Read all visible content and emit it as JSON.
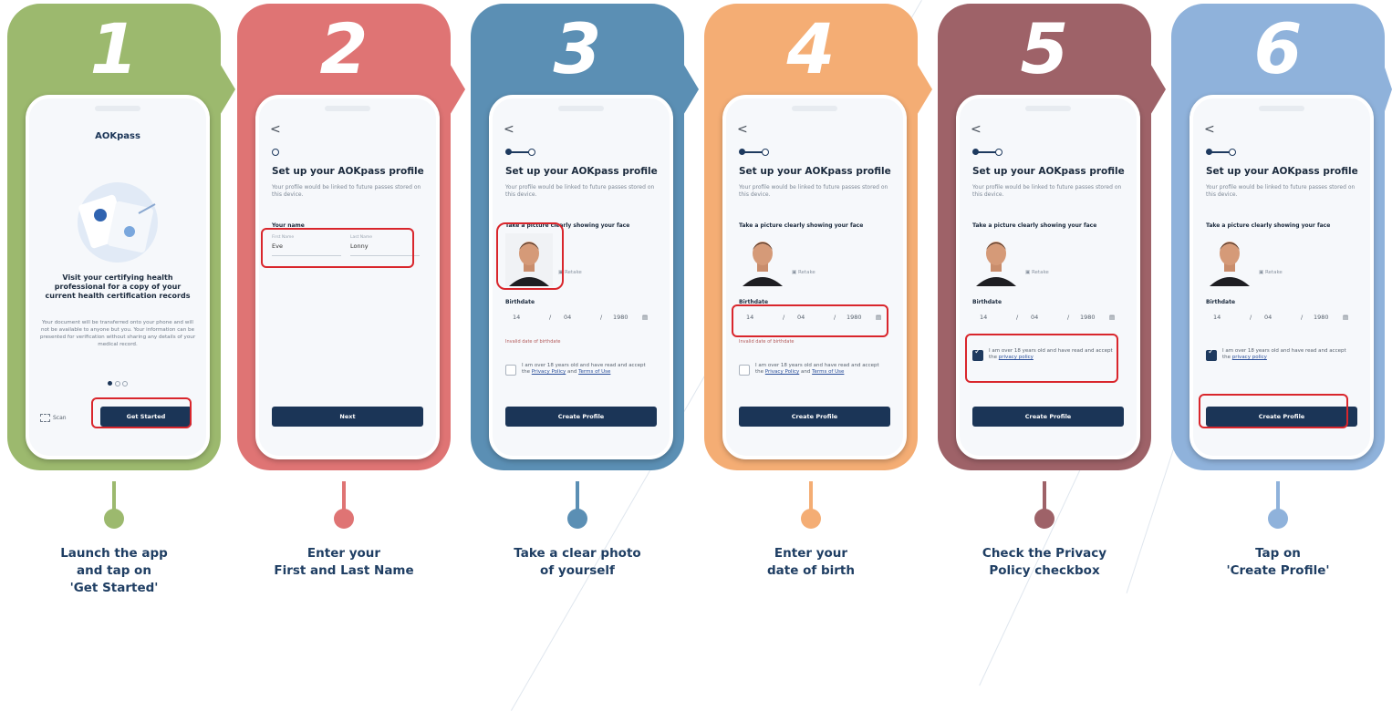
{
  "colors": {
    "step1": "#9cb96e",
    "step2": "#df7474",
    "step3": "#5b8fb4",
    "step4": "#f4ad74",
    "step5": "#9e6268",
    "step6": "#8fb2db",
    "caption": "#1f3e63",
    "highlight": "#d9262c",
    "button": "#1b3557"
  },
  "steps": [
    {
      "number": "1",
      "caption_line1": "Launch the app",
      "caption_line2": "and tap on",
      "caption_line3": "'Get Started'",
      "screen": {
        "logo": "AOKpass",
        "heading": "Visit your certifying health professional for a copy of your current health certification records",
        "body": "Your document will be transferred onto your phone and will not be available to anyone but you. Your information can be presented for verification without sharing any details of your medical record.",
        "scan_label": "Scan",
        "button": "Get Started",
        "icons": [
          "illustration-documents",
          "scan-icon",
          "pagination-dots"
        ]
      }
    },
    {
      "number": "2",
      "caption_line1": "Enter your",
      "caption_line2": "First and Last Name",
      "screen": {
        "back": "<",
        "title": "Set up your AOKpass profile",
        "subtitle": "Your profile would be linked to future passes stored on this device.",
        "name_label": "Your name",
        "first_name_label": "First Name",
        "first_name_value": "Eve",
        "last_name_label": "Last Name",
        "last_name_value": "Lonny",
        "button": "Next"
      }
    },
    {
      "number": "3",
      "caption_line1": "Take a clear photo",
      "caption_line2": "of yourself",
      "screen": {
        "back": "<",
        "title": "Set up your AOKpass profile",
        "subtitle": "Your profile would be linked to future passes stored on this device.",
        "photo_label": "Take a picture clearly showing your face",
        "retake": "Retake",
        "birthdate_label": "Birthdate",
        "day": "14",
        "month": "04",
        "year": "1980",
        "birthdate_hint": "Invalid date of birthdate",
        "consent": "I am over 18 years old and have read and accept the",
        "privacy_link": "Privacy Policy",
        "and": "and",
        "terms_link": "Terms of Use",
        "button": "Create Profile"
      }
    },
    {
      "number": "4",
      "caption_line1": "Enter your",
      "caption_line2": "date of birth",
      "screen": {
        "back": "<",
        "title": "Set up your AOKpass profile",
        "subtitle": "Your profile would be linked to future passes stored on this device.",
        "photo_label": "Take a picture clearly showing your face",
        "retake": "Retake",
        "birthdate_label": "Birthdate",
        "day": "14",
        "month": "04",
        "year": "1980",
        "birthdate_hint": "Invalid date of birthdate",
        "consent": "I am over 18 years old and have read and accept the",
        "privacy_link": "Privacy Policy",
        "and": "and",
        "terms_link": "Terms of Use",
        "button": "Create Profile"
      }
    },
    {
      "number": "5",
      "caption_line1": "Check the Privacy",
      "caption_line2": "Policy checkbox",
      "screen": {
        "back": "<",
        "title": "Set up your AOKpass profile",
        "subtitle": "Your profile would be linked to future passes stored on this device.",
        "photo_label": "Take a picture clearly showing your face",
        "retake": "Retake",
        "birthdate_label": "Birthdate",
        "day": "14",
        "month": "04",
        "year": "1980",
        "consent": "I am over 18 years old and have read and accept the",
        "privacy_link": "privacy policy",
        "button": "Create Profile"
      }
    },
    {
      "number": "6",
      "caption_line1": "Tap on",
      "caption_line2": "'Create Profile'",
      "screen": {
        "back": "<",
        "title": "Set up your AOKpass profile",
        "subtitle": "Your profile would be linked to future passes stored on this device.",
        "photo_label": "Take a picture clearly showing your face",
        "retake": "Retake",
        "birthdate_label": "Birthdate",
        "day": "14",
        "month": "04",
        "year": "1980",
        "consent": "I am over 18 years old and have read and accept the",
        "privacy_link": "privacy policy",
        "button": "Create Profile"
      }
    }
  ]
}
